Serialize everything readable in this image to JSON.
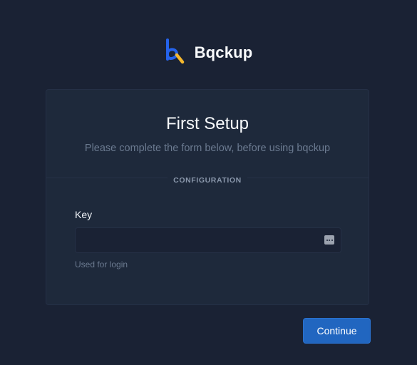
{
  "brand": {
    "name": "Bqckup",
    "logo_icon": "bqckup-logo-icon"
  },
  "card": {
    "title": "First Setup",
    "subtitle": "Please complete the form below, before using bqckup",
    "section_label": "CONFIGURATION"
  },
  "form": {
    "key": {
      "label": "Key",
      "value": "",
      "placeholder": "",
      "hint": "Used for login",
      "icon": "password-manager-icon"
    }
  },
  "actions": {
    "continue_label": "Continue"
  },
  "colors": {
    "background": "#1a2234",
    "card": "#1e293b",
    "primary": "#2166c0",
    "logo_blue": "#2563eb",
    "logo_yellow": "#f5b82e"
  }
}
